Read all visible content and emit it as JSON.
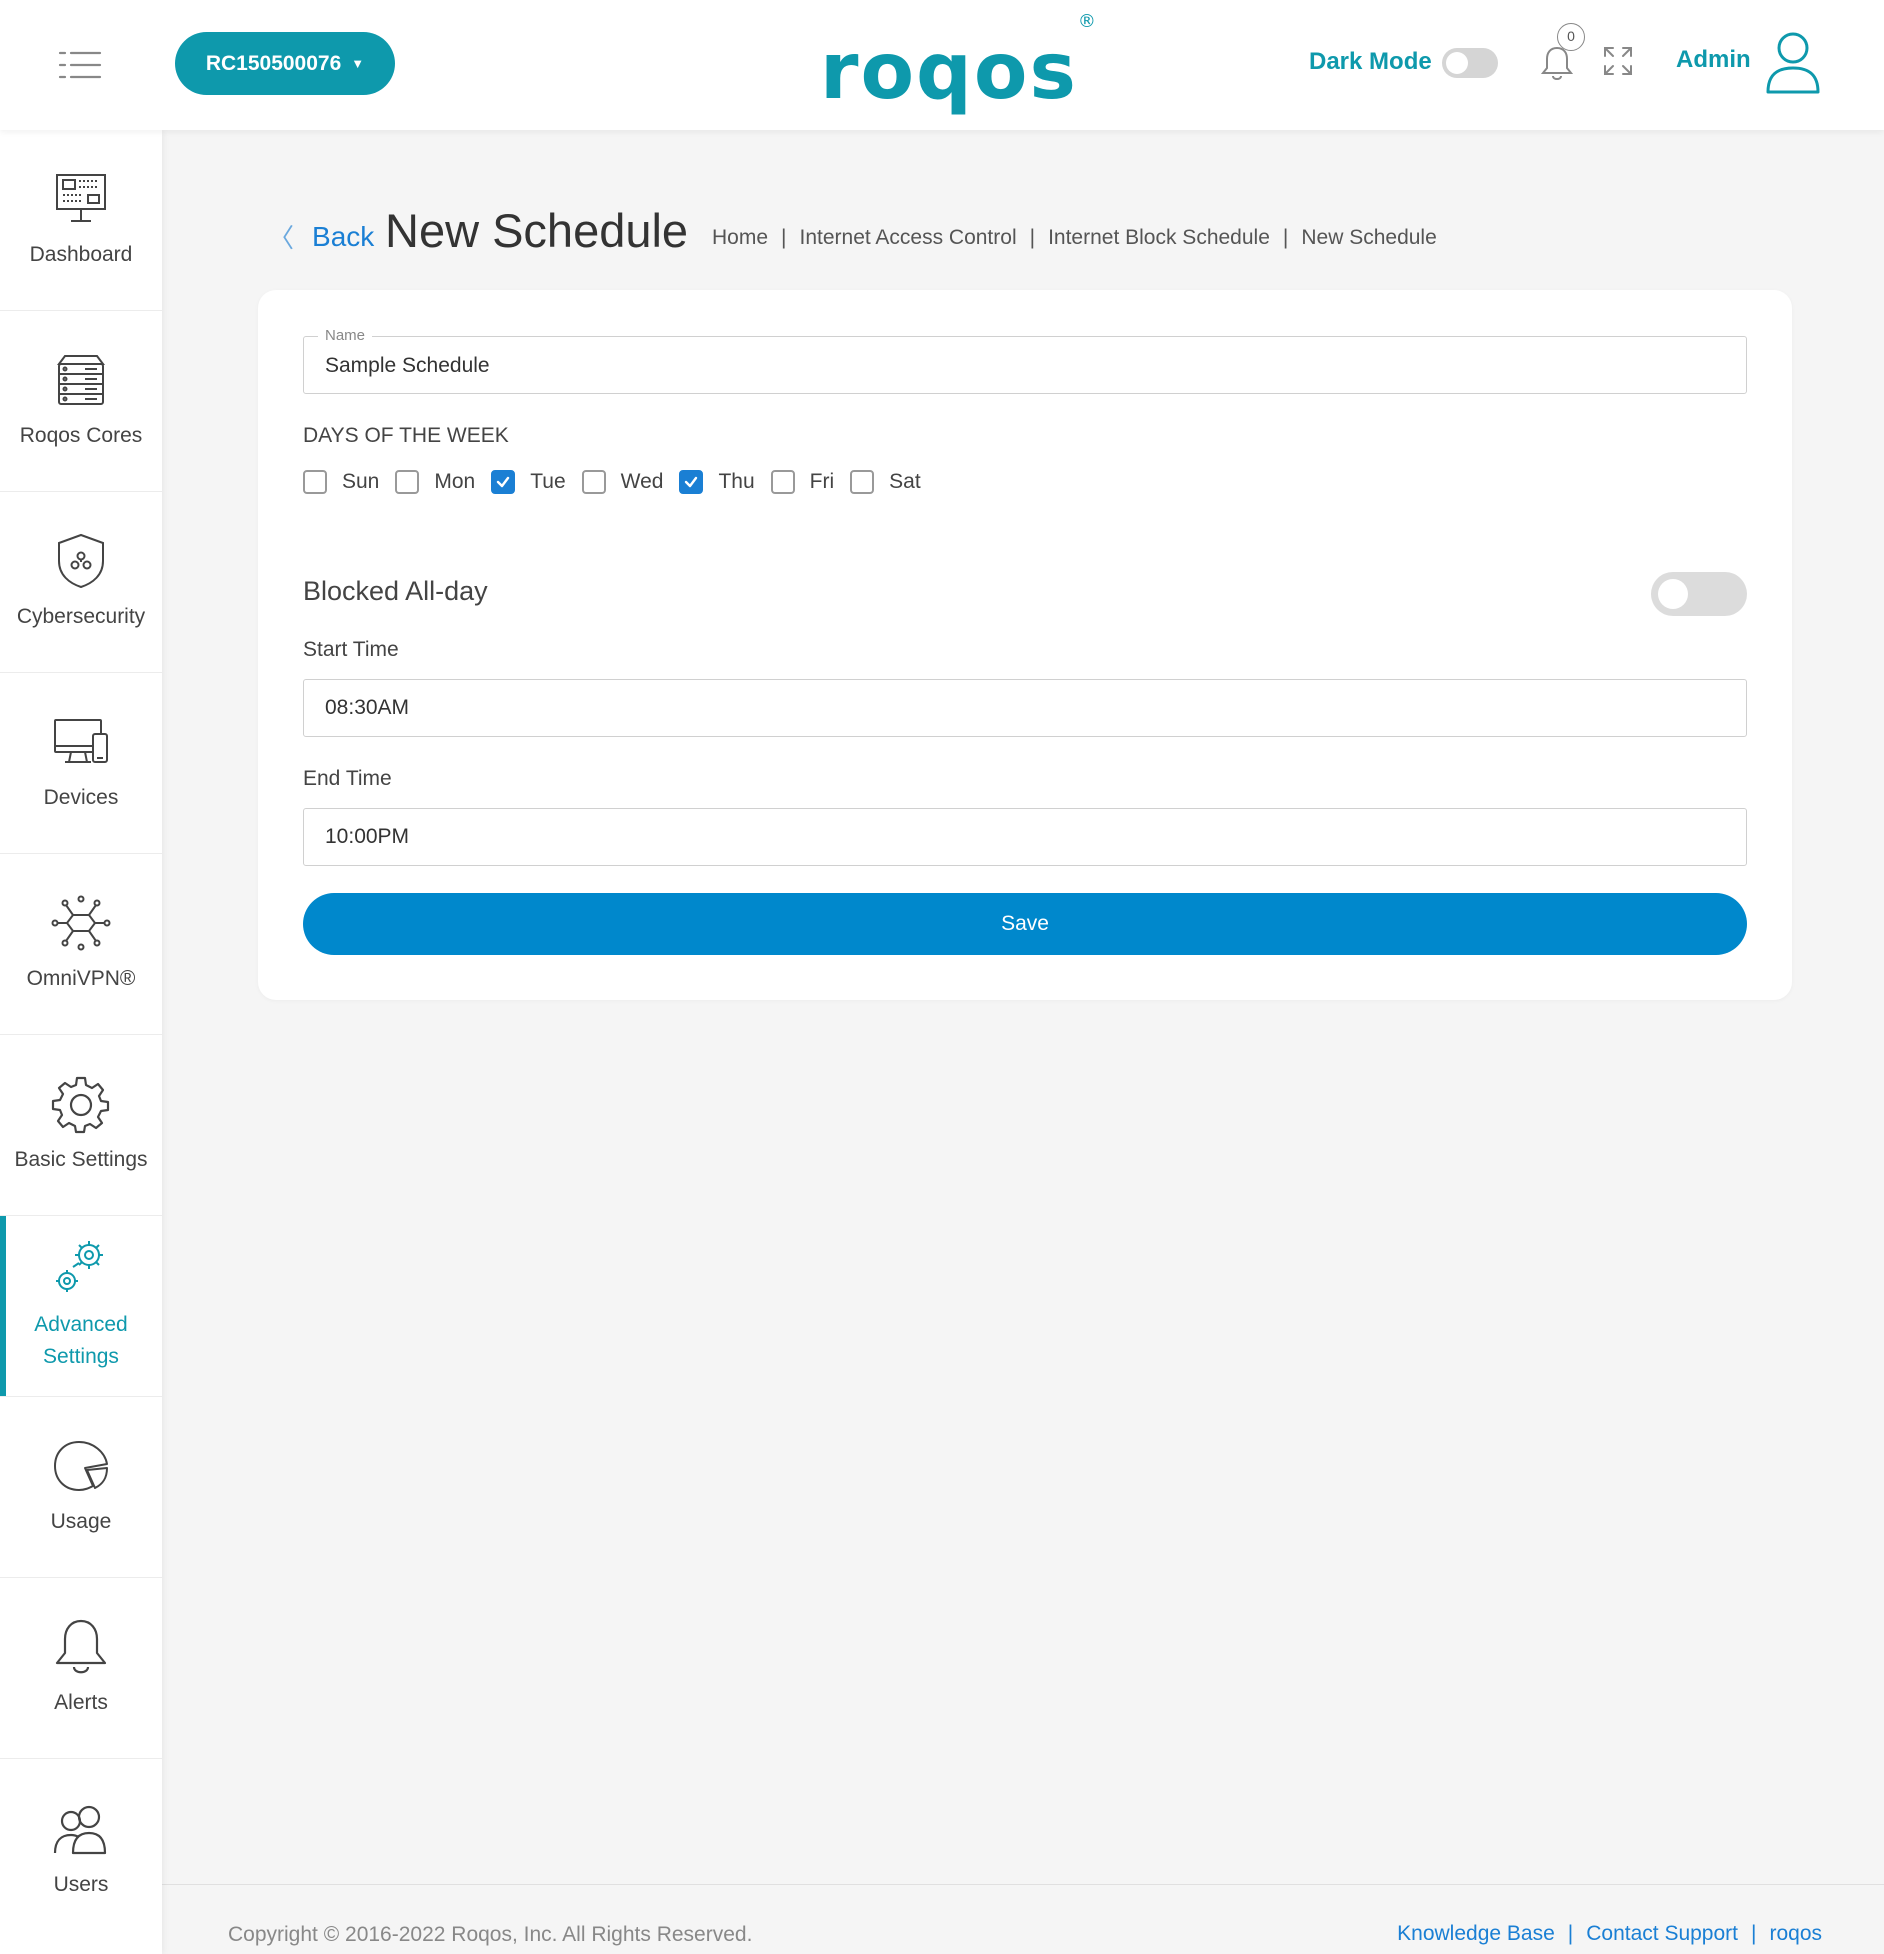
{
  "header": {
    "device_id": "RC150500076",
    "logo_text": "roqos",
    "logo_mark": "®",
    "dark_mode_label": "Dark Mode",
    "dark_mode_on": false,
    "notification_count": "0",
    "admin_label": "Admin",
    "brand_color": "#0e99ac"
  },
  "sidebar": {
    "items": [
      {
        "label": "Dashboard",
        "icon": "dashboard-icon"
      },
      {
        "label": "Roqos Cores",
        "icon": "server-icon"
      },
      {
        "label": "Cybersecurity",
        "icon": "shield-icon"
      },
      {
        "label": "Devices",
        "icon": "devices-icon"
      },
      {
        "label": "OmniVPN®",
        "icon": "network-icon"
      },
      {
        "label": "Basic Settings",
        "icon": "gear-icon"
      },
      {
        "label": "Advanced Settings",
        "icon": "gears-icon",
        "active": true
      },
      {
        "label": "Usage",
        "icon": "pie-chart-icon"
      },
      {
        "label": "Alerts",
        "icon": "bell-icon"
      },
      {
        "label": "Users",
        "icon": "users-icon"
      }
    ]
  },
  "page": {
    "back_label": "Back",
    "title": "New Schedule",
    "breadcrumb": [
      "Home",
      "Internet Access Control",
      "Internet Block Schedule",
      "New Schedule"
    ],
    "breadcrumb_separator": "|"
  },
  "form": {
    "name_label": "Name",
    "name_value": "Sample Schedule",
    "days_title": "DAYS OF THE WEEK",
    "days": [
      {
        "name": "Sun",
        "checked": false
      },
      {
        "name": "Mon",
        "checked": false
      },
      {
        "name": "Tue",
        "checked": true
      },
      {
        "name": "Wed",
        "checked": false
      },
      {
        "name": "Thu",
        "checked": true
      },
      {
        "name": "Fri",
        "checked": false
      },
      {
        "name": "Sat",
        "checked": false
      }
    ],
    "blocked_all_day_label": "Blocked All-day",
    "blocked_all_day": false,
    "start_time_label": "Start Time",
    "start_time_value": "08:30AM",
    "end_time_label": "End Time",
    "end_time_value": "10:00PM",
    "save_label": "Save",
    "save_color": "#0088cc"
  },
  "footer": {
    "copyright": "Copyright © 2016-2022 Roqos, Inc. All Rights Reserved.",
    "links": [
      "Knowledge Base",
      "Contact Support",
      "roqos"
    ],
    "separator": "|"
  }
}
